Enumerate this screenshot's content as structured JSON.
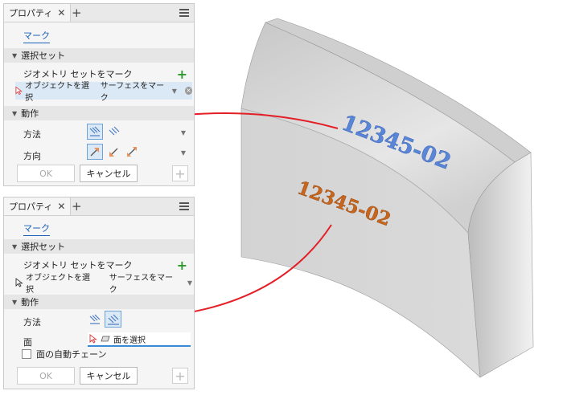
{
  "panel_top": {
    "tab_title": "プロパティ",
    "mark_link": "マーク",
    "selection_set": "選択セット",
    "geometry_label": "ジオメトリ セットをマーク",
    "object_select": "オブジェクトを選択",
    "surface_mark": "サーフェスをマーク",
    "action": "動作",
    "method_label": "方法",
    "direction_label": "方向",
    "ok": "OK",
    "cancel": "キャンセル"
  },
  "panel_bottom": {
    "tab_title": "プロパティ",
    "mark_link": "マーク",
    "selection_set": "選択セット",
    "geometry_label": "ジオメトリ セットをマーク",
    "object_select": "オブジェクトを選択",
    "surface_mark": "サーフェスをマーク",
    "action": "動作",
    "method_label": "方法",
    "face_label": "面",
    "face_select": "面を選択",
    "auto_chain": "面の自動チェーン",
    "ok": "OK",
    "cancel": "キャンセル"
  },
  "model": {
    "blue_text": "12345-02",
    "orange_text": "12345-02"
  },
  "colors": {
    "blue_text": "#5a86d8",
    "orange_text": "#c7661c",
    "leader": "#e41e26",
    "accent": "#1a62b8"
  }
}
